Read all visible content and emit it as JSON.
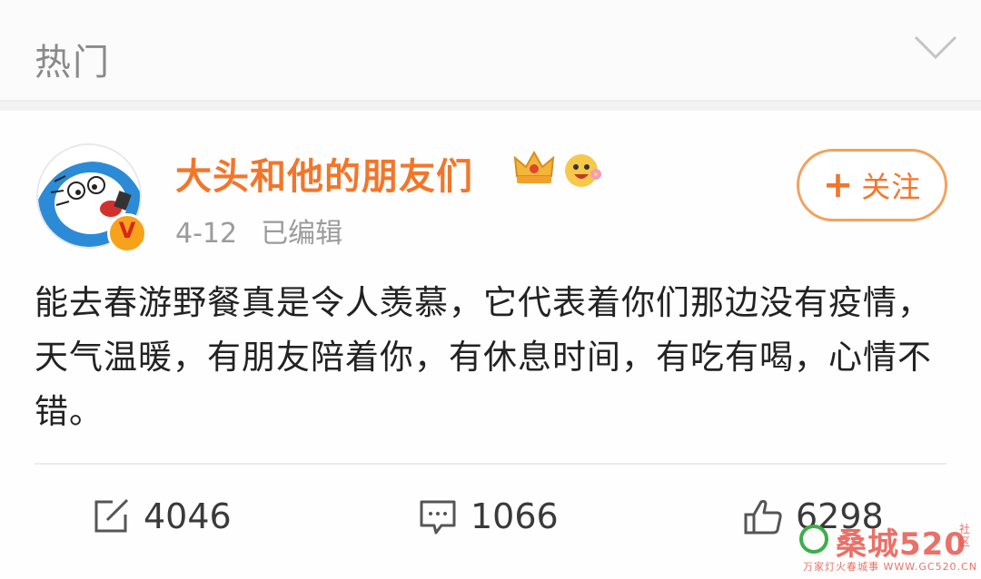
{
  "header": {
    "title": "热门",
    "collapse_icon": "chevron-down-icon"
  },
  "post": {
    "username": "大头和他的朋友们",
    "badges": [
      "crown-icon",
      "emoji-face-icon"
    ],
    "date": "4-12",
    "edited_label": "已编辑",
    "follow_label": "关注",
    "follow_plus": "+",
    "text": "能去春游野餐真是令人羡慕，它代表着你们那边没有疫情，天气温暖，有朋友陪着你，有休息时间，有吃有喝，心情不错。"
  },
  "actions": {
    "repost_count": "4046",
    "comment_count": "1066",
    "like_count": "6298"
  },
  "watermark": {
    "text": "桑城520",
    "subtext": "万家灯火春城事 WWW.GC520.CN",
    "side": "社区"
  },
  "colors": {
    "accent": "#f2762a",
    "follow_border": "#f3a15d",
    "text": "#222222",
    "muted": "#9b9b9b"
  }
}
